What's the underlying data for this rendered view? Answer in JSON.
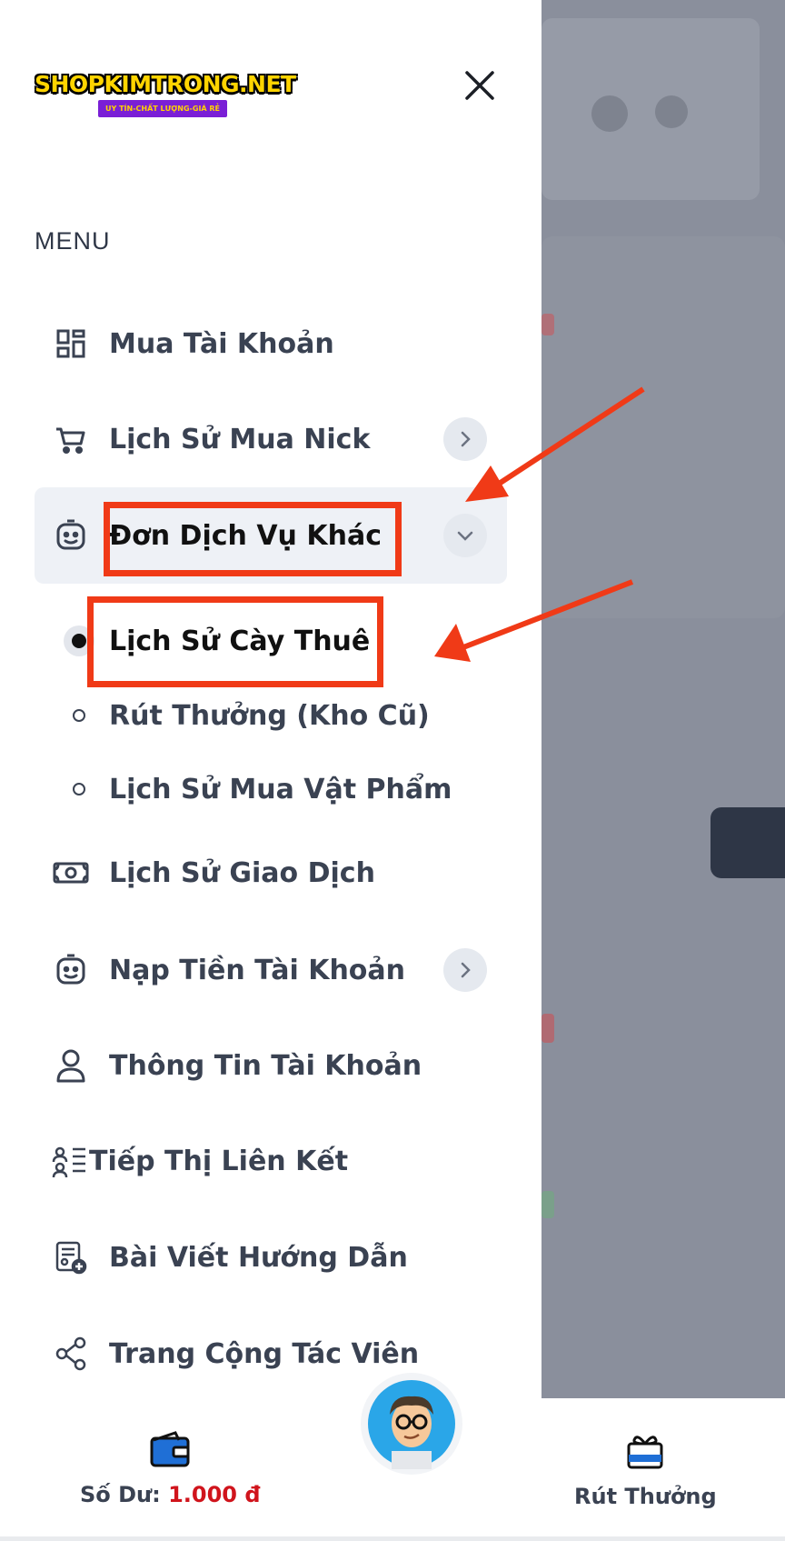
{
  "logo": {
    "main": "SHOPKIMTRONG.NET",
    "tagline": "UY TÍN-CHẤT LƯỢNG-GIÁ RẺ"
  },
  "menu": {
    "title": "MENU",
    "items": [
      {
        "label": "Mua Tài Khoản",
        "icon": "grid-icon"
      },
      {
        "label": "Lịch Sử Mua Nick",
        "icon": "cart-icon"
      },
      {
        "label": "Đơn Dịch Vụ Khác",
        "icon": "robot-face-icon"
      },
      {
        "label": "Lịch Sử Giao Dịch",
        "icon": "banknote-icon"
      },
      {
        "label": "Nạp Tiền Tài Khoản",
        "icon": "robot-face-icon"
      },
      {
        "label": "Thông Tin Tài Khoản",
        "icon": "user-icon"
      },
      {
        "label": "Tiếp Thị Liên Kết",
        "icon": "affiliate-icon"
      },
      {
        "label": "Bài Viết Hướng Dẫn",
        "icon": "document-icon"
      },
      {
        "label": "Trang Cộng Tác Viên",
        "icon": "share-icon"
      }
    ],
    "subitems": [
      {
        "label": "Lịch Sử Cày Thuê"
      },
      {
        "label": "Rút Thưởng (Kho Cũ)"
      },
      {
        "label": "Lịch Sử Mua Vật Phẩm"
      }
    ]
  },
  "bottom": {
    "balance_label": "Số Dư:",
    "balance_value": "1.000 đ",
    "reward_label": "Rút Thưởng"
  },
  "colors": {
    "highlight": "#f03a17",
    "accent": "#1f6fd6",
    "money": "#d0141c"
  }
}
